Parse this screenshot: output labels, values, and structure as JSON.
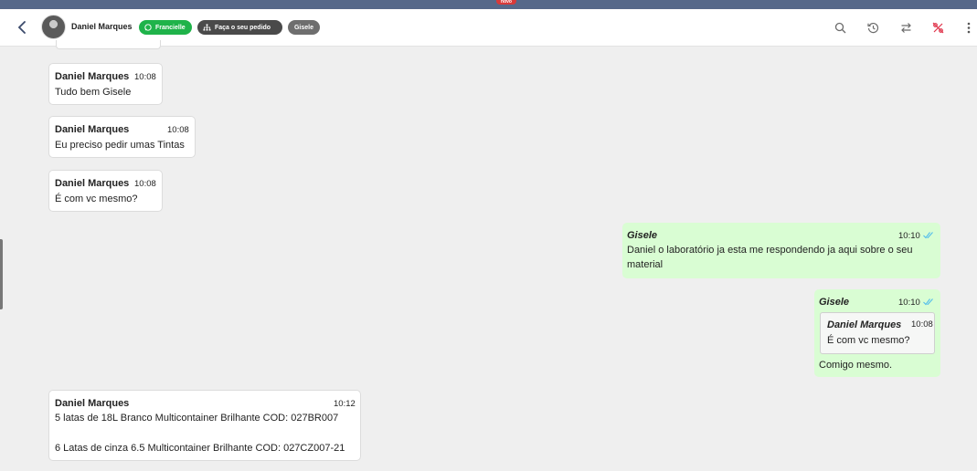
{
  "header": {
    "contact_name": "Daniel Marques",
    "tags": {
      "whatsapp": "Francielle",
      "order": "Faça o seu pedido",
      "agent": "Gisele"
    },
    "icons": [
      "back-arrow-icon",
      "search-icon",
      "history-icon",
      "transfer-icon",
      "percent-off-icon",
      "more-vertical-icon"
    ]
  },
  "top_badge": "novo",
  "messages": [
    {
      "direction": "in",
      "author": "Daniel Marques",
      "time": "10:08",
      "lines": [
        "Tudo bem Gisele"
      ]
    },
    {
      "direction": "in",
      "author": "Daniel Marques",
      "time": "10:08",
      "lines": [
        "Eu preciso pedir umas Tintas"
      ]
    },
    {
      "direction": "in",
      "author": "Daniel Marques",
      "time": "10:08",
      "lines": [
        "É com vc mesmo?"
      ]
    },
    {
      "direction": "out",
      "author": "Gisele",
      "time": "10:10",
      "status": "read",
      "lines": [
        "Daniel o laboratório ja esta me respondendo ja aqui sobre o seu",
        "material"
      ]
    },
    {
      "direction": "out",
      "author": "Gisele",
      "time": "10:10",
      "status": "read",
      "quote": {
        "author": "Daniel Marques",
        "time": "10:08",
        "text": "É com vc mesmo?"
      },
      "lines": [
        "Comigo mesmo."
      ]
    },
    {
      "direction": "in",
      "author": "Daniel Marques",
      "time": "10:12",
      "lines": [
        "5 latas de 18L Branco Multicontainer Brilhante COD: 027BR007",
        "",
        "6 Latas de cinza 6.5 Multicontainer Brilhante COD: 027CZ007-21"
      ]
    }
  ],
  "colors": {
    "incoming_bubble": "#ffffff",
    "outgoing_bubble": "#d9fdd3",
    "chat_background": "#efefef",
    "read_ticks": "#53bdeb",
    "whatsapp_tag": "#1fb34a",
    "alert_icon": "#e0344b"
  }
}
